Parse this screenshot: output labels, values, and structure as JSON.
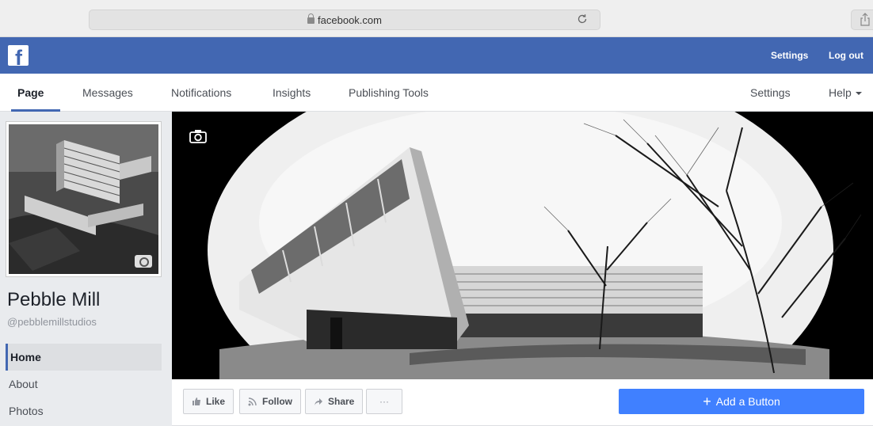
{
  "browser": {
    "url": "facebook.com"
  },
  "topbar": {
    "settings_label": "Settings",
    "logout_label": "Log out",
    "logo_letter": "f"
  },
  "page_nav": {
    "tabs": [
      {
        "label": "Page"
      },
      {
        "label": "Messages"
      },
      {
        "label": "Notifications"
      },
      {
        "label": "Insights"
      },
      {
        "label": "Publishing Tools"
      }
    ],
    "right": {
      "settings_label": "Settings",
      "help_label": "Help"
    }
  },
  "profile": {
    "name": "Pebble Mill",
    "handle": "@pebblemillstudios"
  },
  "side_nav": {
    "items": [
      {
        "label": "Home"
      },
      {
        "label": "About"
      },
      {
        "label": "Photos"
      }
    ]
  },
  "actions": {
    "like_label": "Like",
    "follow_label": "Follow",
    "share_label": "Share",
    "more_label": "···",
    "add_button_label": "Add a Button"
  },
  "colors": {
    "brand": "#4267b2",
    "cta": "#4080ff",
    "background": "#e9ebee"
  }
}
